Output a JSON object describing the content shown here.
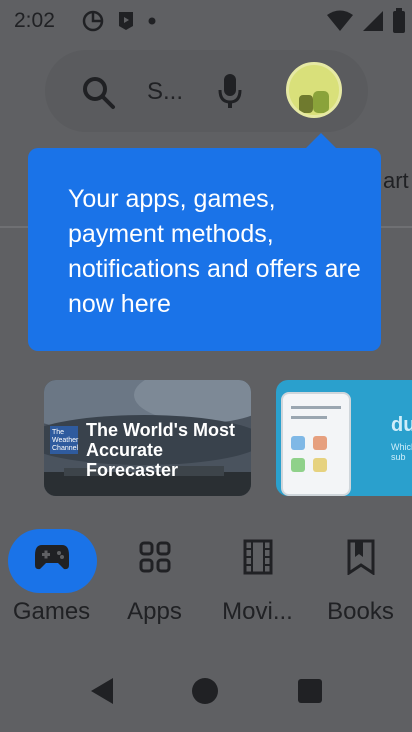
{
  "status_bar": {
    "time": "2:02",
    "left_icons": [
      "google-photos-icon",
      "youtube-icon",
      "notification-dot-icon"
    ],
    "right_icons": [
      "wifi-icon",
      "signal-icon",
      "battery-icon"
    ]
  },
  "search": {
    "placeholder": "S..."
  },
  "top_tabs": {
    "partial_label": "art"
  },
  "tooltip": {
    "message": "Your apps, games, payment methods, notifications and offers are now here"
  },
  "cards": [
    {
      "brand": "The Weather Channel",
      "title": "The World's Most Accurate Forecaster"
    },
    {
      "brand": "du",
      "subtitle": "Which sub"
    }
  ],
  "bottom_nav": {
    "items": [
      {
        "label": "Games",
        "icon": "gamepad-icon",
        "active": true
      },
      {
        "label": "Apps",
        "icon": "apps-grid-icon",
        "active": false
      },
      {
        "label": "Movi...",
        "icon": "movie-film-icon",
        "active": false
      },
      {
        "label": "Books",
        "icon": "bookmark-icon",
        "active": false
      }
    ]
  },
  "colors": {
    "accent": "#1a73e8",
    "background": "#5f6063"
  }
}
